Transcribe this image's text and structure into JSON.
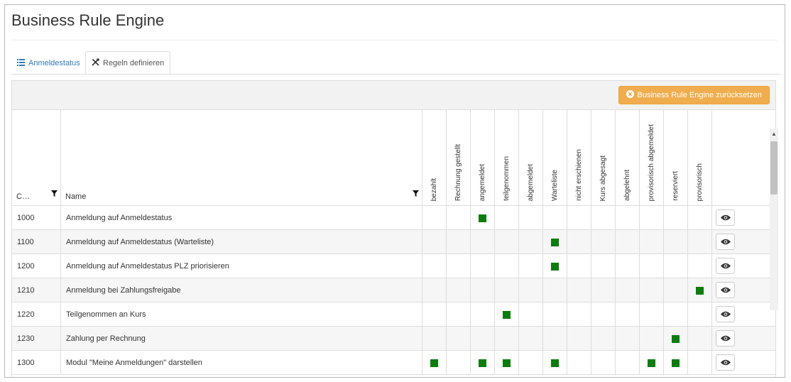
{
  "title": "Business Rule Engine",
  "tabs": [
    {
      "label": "Anmeldestatus",
      "icon": "list-icon"
    },
    {
      "label": "Regeln definieren",
      "icon": "tools-icon"
    }
  ],
  "reset_button": {
    "label": "Business Rule Engine zurücksetzen",
    "icon": "x-circle-icon"
  },
  "columns": {
    "code": "C…",
    "name": "Name",
    "statuses": [
      "bezahlt",
      "Rechnung gestellt",
      "angemeldet",
      "teilgenommen",
      "abgemeldet",
      "Warteliste",
      "nicht erschienen",
      "Kurs abgesagt",
      "abgelehnt",
      "provisorisch abgemeldet",
      "reserviert",
      "provisorisch"
    ]
  },
  "rows": [
    {
      "code": "1000",
      "name": "Anmeldung auf Anmeldestatus",
      "marks": [
        2
      ]
    },
    {
      "code": "1100",
      "name": "Anmeldung auf Anmeldestatus (Warteliste)",
      "marks": [
        5
      ]
    },
    {
      "code": "1200",
      "name": "Anmeldung auf Anmeldestatus PLZ priorisieren",
      "marks": [
        5
      ]
    },
    {
      "code": "1210",
      "name": "Anmeldung bei Zahlungsfreigabe",
      "marks": [
        11
      ]
    },
    {
      "code": "1220",
      "name": "Teilgenommen an Kurs",
      "marks": [
        3
      ]
    },
    {
      "code": "1230",
      "name": "Zahlung per Rechnung",
      "marks": [
        10
      ]
    },
    {
      "code": "1300",
      "name": "Modul \"Meine Anmeldungen\" darstellen",
      "marks": [
        0,
        2,
        3,
        5,
        9,
        10
      ]
    }
  ],
  "colors": {
    "mark": "#0a7d0a",
    "warning": "#f0ad4e",
    "link": "#337ab7"
  }
}
